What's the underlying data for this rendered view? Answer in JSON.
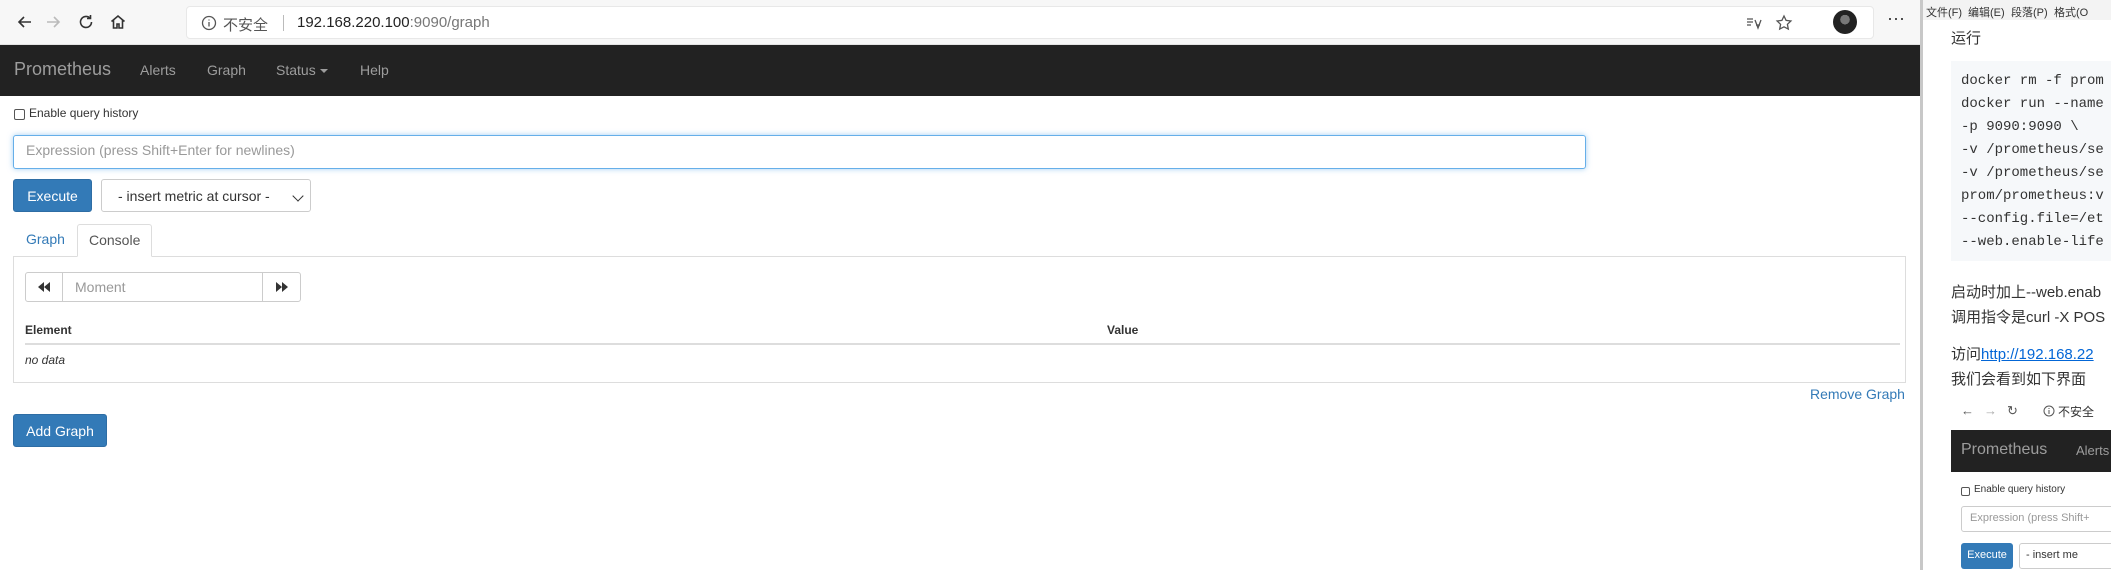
{
  "browser": {
    "address": {
      "security_label": "不安全",
      "url_host": "192.168.220.100",
      "url_rest": ":9090/graph"
    },
    "icons": {
      "back": "back-arrow-icon",
      "forward": "forward-arrow-icon",
      "refresh": "refresh-icon",
      "home": "home-icon",
      "info": "info-circle-icon",
      "reader": "reader-mode-icon",
      "favorite": "star-icon",
      "more": "more-dots-icon"
    }
  },
  "prometheus": {
    "brand": "Prometheus",
    "nav": {
      "alerts": "Alerts",
      "graph": "Graph",
      "status": "Status",
      "help": "Help"
    },
    "query_history_label": "Enable query history",
    "expression_placeholder": "Expression (press Shift+Enter for newlines)",
    "execute_label": "Execute",
    "metric_select_value": "- insert metric at cursor -",
    "tabs": {
      "graph": "Graph",
      "console": "Console"
    },
    "moment_placeholder": "Moment",
    "table": {
      "headers": [
        "Element",
        "Value"
      ],
      "empty_text": "no data"
    },
    "remove_graph_label": "Remove Graph",
    "add_graph_label": "Add Graph",
    "colors": {
      "navbar_bg": "#222222",
      "primary": "#337ab7"
    }
  },
  "doc": {
    "menu": [
      "文件(F)",
      "编辑(E)",
      "段落(P)",
      "格式(O"
    ],
    "run_heading": "运行",
    "code_lines": [
      "docker rm -f prom",
      "docker run --name",
      "-p 9090:9090 \\",
      "-v /prometheus/se",
      "-v /prometheus/se",
      "prom/prometheus:v",
      "--config.file=/et",
      "--web.enable-life"
    ],
    "text_line_1": "启动时加上--web.enab",
    "text_line_2": "调用指令是curl -X POS",
    "visit_prefix": "访问",
    "visit_link": "http://192.168.22",
    "text_line_4": "我们会看到如下界面",
    "mini": {
      "insecure": "不安全",
      "brand": "Prometheus",
      "alerts": "Alerts",
      "history": "Enable query history",
      "expression": "Expression (press Shift+",
      "execute": "Execute",
      "metric": "- insert me"
    }
  }
}
